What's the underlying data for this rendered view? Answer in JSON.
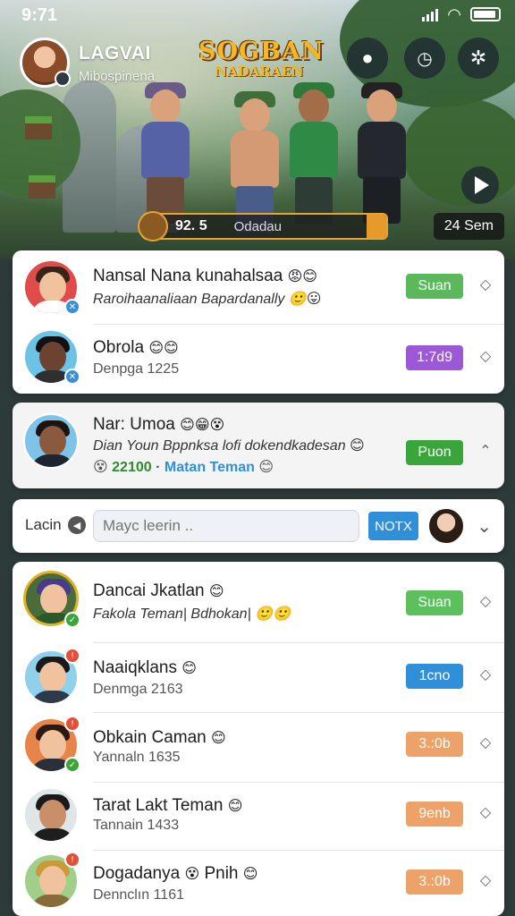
{
  "status_bar": {
    "time": "9:71"
  },
  "profile": {
    "name": "LAGVAI",
    "subtitle": "Mibospinena"
  },
  "game_logo": {
    "line1": "SOGBAN",
    "line2": "NADARAEN"
  },
  "progress": {
    "value_text": "92. 5",
    "label": "Odadau",
    "fill_fraction": 0.08
  },
  "timer": "24 Sem",
  "colors": {
    "green": "#5cb85c",
    "purple": "#9b59d6",
    "blue": "#2f8fd8",
    "orange": "#eda26a"
  },
  "card1": {
    "rows": [
      {
        "name": "Nansal Nana kunahalsaa",
        "name_emoji": "😡😊",
        "sub": "Raroihaanaliaan Bapardanally",
        "sub_emoji": "🙂😛",
        "button": "Suan",
        "button_color": "green",
        "chevron": "◇"
      },
      {
        "name": "Obrola",
        "name_emoji": "😊😊",
        "sub": "Denpga 1225",
        "sub_emoji": "",
        "button": "1:7d9",
        "button_color": "purple",
        "chevron": "◇"
      }
    ]
  },
  "card2": {
    "name": "Nar: Umoa",
    "name_emoji": "😊😁😵",
    "sub": "Dian Youn Bppnksa lofi dokendkadesan",
    "sub_emoji": "😊",
    "stat_emoji": "😵",
    "stat_value": "22100",
    "stat_sep": "·",
    "stat_link": "Matan Teman",
    "stat_emoji2": "😊",
    "button": "Puon",
    "chevron": "⌃"
  },
  "compose": {
    "label": "Lacin",
    "placeholder": "Mayc leerin ..",
    "button": "NOTX",
    "chevron": "⌄"
  },
  "card3": {
    "rows": [
      {
        "name": "Dancai Jkatlan",
        "name_emoji": "😊",
        "sub": "Fakola Teman| Bdhokan|",
        "sub_emoji": "🙂🙂",
        "button": "Suan",
        "button_color": "green",
        "chevron": "◇"
      },
      {
        "name": "Naaiqklans",
        "name_emoji": "😊",
        "sub": "Denmga 2163",
        "sub_emoji": "",
        "button": "1cno",
        "button_color": "blue",
        "chevron": "◇"
      },
      {
        "name": "Obkain Caman",
        "name_emoji": "😊",
        "sub": "Yannaln 1635",
        "sub_emoji": "",
        "button": "3.:0b",
        "button_color": "orange",
        "chevron": "◇"
      },
      {
        "name": "Tarat Lakt Teman",
        "name_emoji": "😊",
        "sub": "Tannain 1433",
        "sub_emoji": "",
        "button": "9enb",
        "button_color": "orange",
        "chevron": "◇"
      },
      {
        "name": "Dogadanya",
        "name_emoji": "😵",
        "name_after": "Pnih",
        "name_emoji2": "😊",
        "sub": "Dennclın 1161",
        "sub_emoji": "",
        "button": "3.:0b",
        "button_color": "orange",
        "chevron": "◇"
      }
    ]
  }
}
